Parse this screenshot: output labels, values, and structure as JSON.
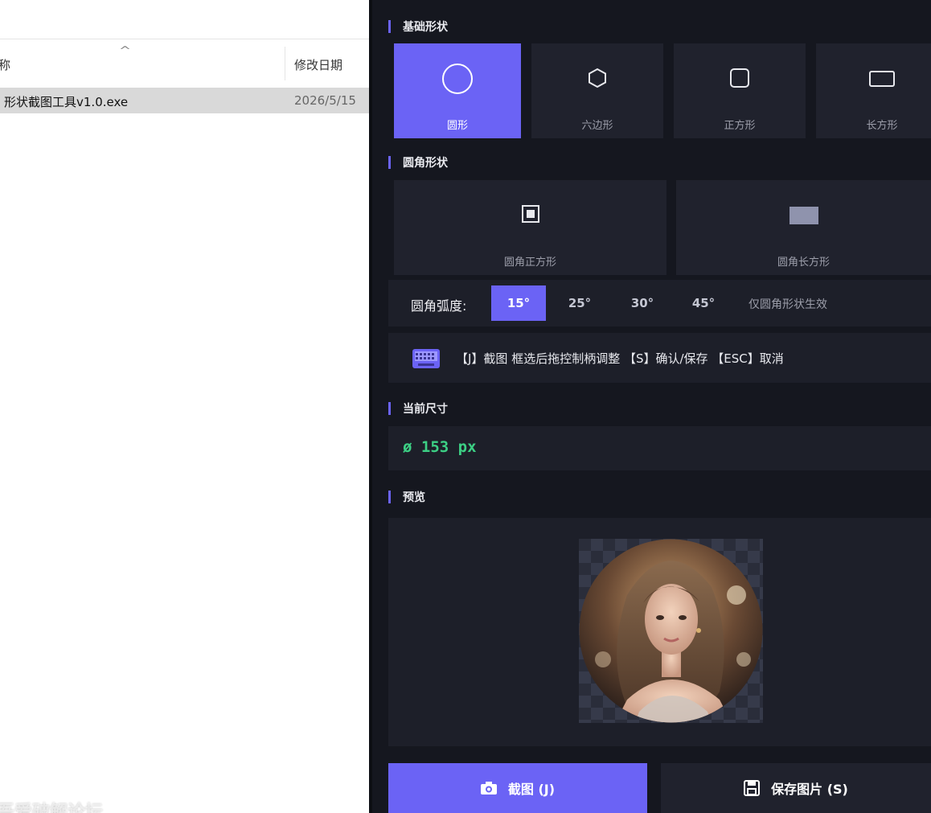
{
  "explorer": {
    "columns": {
      "name": "称",
      "modified": "修改日期"
    },
    "rows": [
      {
        "name": "形状截图工具v1.0.exe",
        "modified": "2026/5/15"
      }
    ],
    "watermark": "吾爱破解论坛"
  },
  "panel": {
    "basic_shapes": {
      "title": "基础形状",
      "items": [
        {
          "label": "圆形",
          "icon": "circle-icon",
          "selected": true
        },
        {
          "label": "六边形",
          "icon": "hexagon-icon",
          "selected": false
        },
        {
          "label": "正方形",
          "icon": "square-icon",
          "selected": false
        },
        {
          "label": "长方形",
          "icon": "rectangle-icon",
          "selected": false
        }
      ]
    },
    "rounded_shapes": {
      "title": "圆角形状",
      "items": [
        {
          "label": "圆角正方形",
          "icon": "rounded-square-icon"
        },
        {
          "label": "圆角长方形",
          "icon": "rounded-rectangle-icon"
        }
      ]
    },
    "corner_radius": {
      "label": "圆角弧度:",
      "options": [
        "15°",
        "25°",
        "30°",
        "45°"
      ],
      "selected": "15°",
      "note": "仅圆角形状生效"
    },
    "hotkeys": {
      "icon": "keyboard-icon",
      "text": "【J】截图  框选后拖控制柄调整  【S】确认/保存  【ESC】取消"
    },
    "current_size": {
      "title": "当前尺寸",
      "value": "ø 153 px"
    },
    "preview": {
      "title": "预览",
      "shape": "circle"
    },
    "buttons": {
      "capture": {
        "label": "截图 (J)",
        "icon": "camera-icon"
      },
      "save": {
        "label": "保存图片 (S)",
        "icon": "save-icon"
      }
    },
    "colors": {
      "background": "#15171f",
      "card": "#20222d",
      "accent": "#6b63f5",
      "size_text": "#3ccf84"
    }
  }
}
